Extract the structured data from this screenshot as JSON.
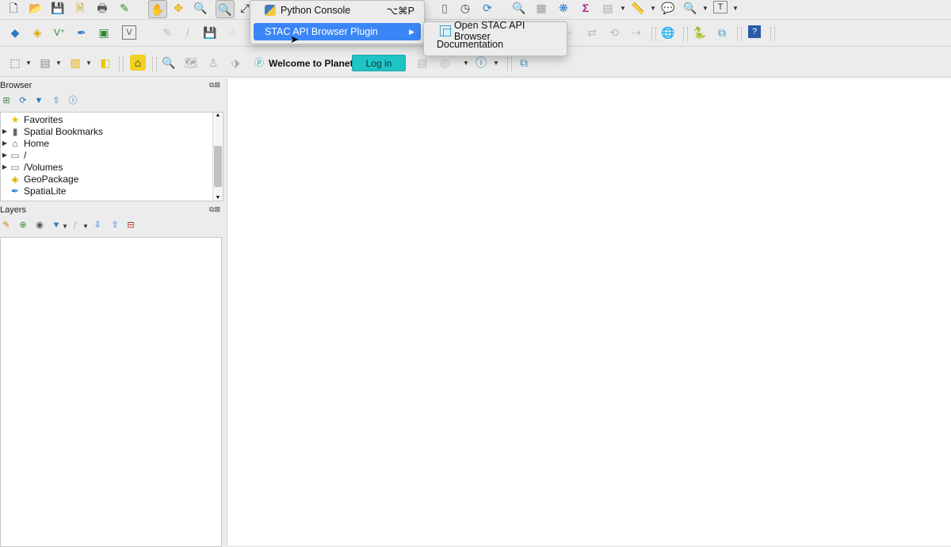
{
  "menu": {
    "items": [
      {
        "label": "Python Console",
        "shortcut": "⌥⌘P",
        "icon": "python-icon"
      },
      {
        "label": "STAC API Browser Plugin",
        "arrow": "▶",
        "icon": "none"
      }
    ],
    "submenu": {
      "items": [
        {
          "label": "Open STAC API Browser",
          "icon": "stac-plugin-icon"
        },
        {
          "label": "Documentation"
        }
      ]
    },
    "highlight_color": "#3a86f7"
  },
  "planet": {
    "welcome": "Welcome to Planet",
    "login_label": "Log in",
    "button_color": "#1fc4c4"
  },
  "browser_panel": {
    "title": "Browser",
    "items": [
      {
        "label": "Favorites",
        "icon": "star-icon",
        "expandable": false
      },
      {
        "label": "Spatial Bookmarks",
        "icon": "bookmark-icon",
        "expandable": true
      },
      {
        "label": "Home",
        "icon": "home-folder-icon",
        "expandable": true
      },
      {
        "label": "/",
        "icon": "folder-icon",
        "expandable": true
      },
      {
        "label": "/Volumes",
        "icon": "folder-icon",
        "expandable": true
      },
      {
        "label": "GeoPackage",
        "icon": "geopackage-icon",
        "expandable": false
      },
      {
        "label": "SpatiaLite",
        "icon": "spatialite-icon",
        "expandable": false
      }
    ]
  },
  "layers_panel": {
    "title": "Layers"
  }
}
